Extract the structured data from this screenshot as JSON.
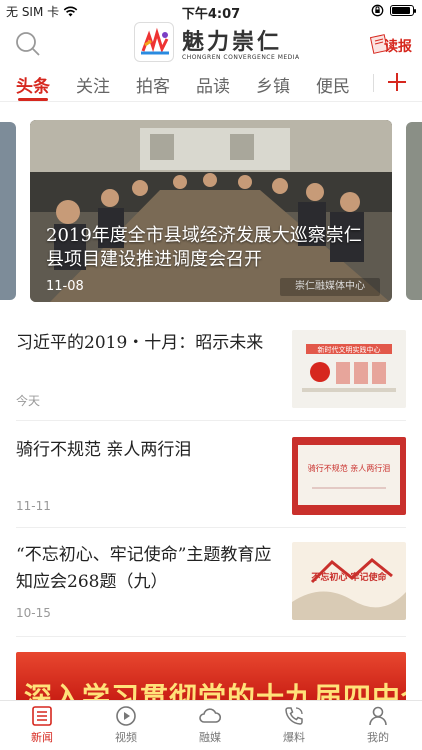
{
  "status_bar": {
    "carrier": "无 SIM 卡",
    "time": "下午4:07",
    "battery_level": 0.9
  },
  "header": {
    "app_name_cn": "魅力崇仁",
    "app_name_en": "CHONGREN CONVERGENCE MEDIA",
    "read_paper_label": "读报"
  },
  "tabs": [
    {
      "label": "头条",
      "active": true
    },
    {
      "label": "关注",
      "active": false
    },
    {
      "label": "拍客",
      "active": false
    },
    {
      "label": "品读",
      "active": false
    },
    {
      "label": "乡镇",
      "active": false
    },
    {
      "label": "便民",
      "active": false
    }
  ],
  "carousel": {
    "caption": "2019年度全市县域经济发展大巡察崇仁县项目建设推进调度会召开",
    "date": "11-08",
    "watermark": "崇仁融媒体中心"
  },
  "news": [
    {
      "title": "习近平的2019・十月：昭示未来",
      "time": "今天",
      "thumb_text": "新时代文明实践中心"
    },
    {
      "title": "骑行不规范  亲人两行泪",
      "time": "11-11",
      "thumb_text": "骑行不规范 亲人两行泪"
    },
    {
      "title": "“不忘初心、牢记使命”主题教育应知应会268题（九）",
      "time": "10-15",
      "thumb_text": "不忘初心 牢记使命"
    }
  ],
  "banner": {
    "text": "深入学习贯彻党的十九届四中全会精神"
  },
  "bottom_nav": [
    {
      "label": "新闻",
      "icon": "news-icon",
      "active": true
    },
    {
      "label": "视频",
      "icon": "play-icon",
      "active": false
    },
    {
      "label": "融媒",
      "icon": "cloud-icon",
      "active": false
    },
    {
      "label": "爆料",
      "icon": "phone-icon",
      "active": false
    },
    {
      "label": "我的",
      "icon": "person-icon",
      "active": false
    }
  ],
  "colors": {
    "accent": "#d6271e",
    "text": "#222222",
    "muted": "#999999"
  }
}
